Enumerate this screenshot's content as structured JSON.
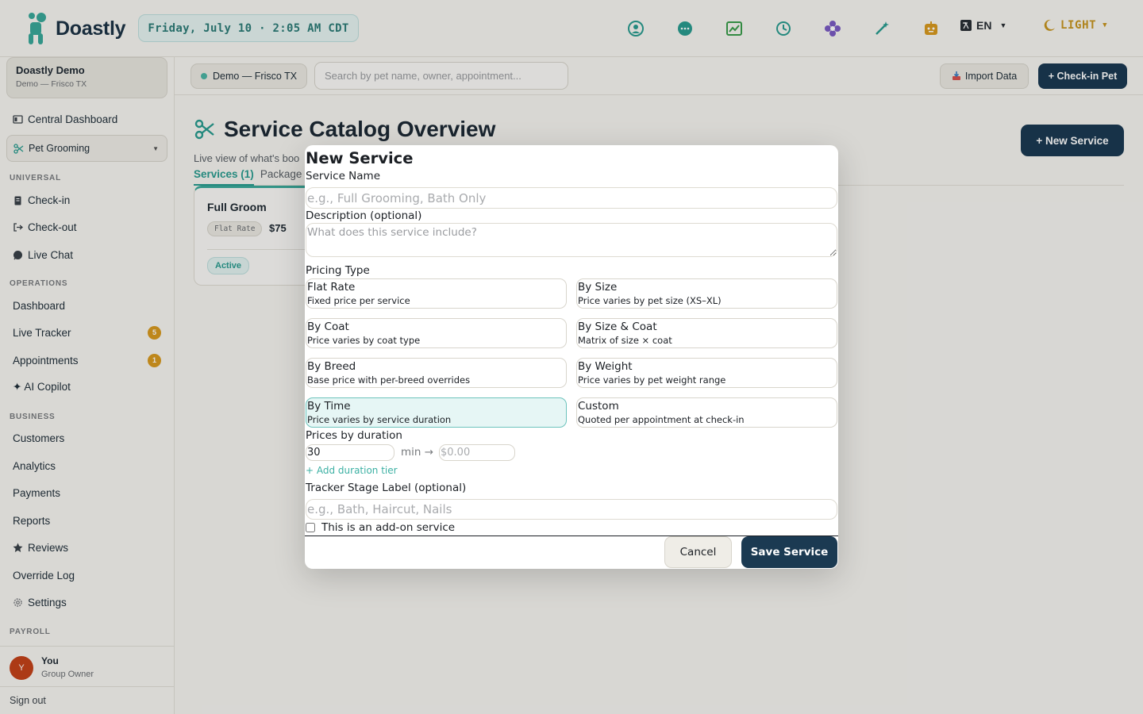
{
  "header": {
    "app_name": "Doastly",
    "date_time": "Friday, July 10 · 2:05 AM CDT",
    "language": "EN",
    "theme": "LIGHT",
    "icons": [
      "person-icon",
      "chat-bubble-icon",
      "trend-chart-icon",
      "clock-history-icon",
      "flower-icon",
      "magic-wand-icon",
      "robot-icon"
    ]
  },
  "sidebar": {
    "org_name": "Doastly Demo",
    "org_sub": "Demo — Frisco TX",
    "central_dashboard": "Central Dashboard",
    "active_module": "Pet Grooming",
    "section_universal": "UNIVERSAL",
    "universal_items": [
      "Check-in",
      "Check-out",
      "Live Chat"
    ],
    "section_operations": "OPERATIONS",
    "operations_items": [
      {
        "label": "Dashboard"
      },
      {
        "label": "Live Tracker",
        "badge": "5"
      },
      {
        "label": "Appointments",
        "badge": "1"
      },
      {
        "label": "✦ AI Copilot"
      }
    ],
    "section_business": "BUSINESS",
    "business_items": [
      "Customers",
      "Analytics",
      "Payments",
      "Reports",
      "Reviews",
      "Override Log",
      "Settings"
    ],
    "section_payroll": "PAYROLL",
    "user": {
      "initial": "Y",
      "name": "You",
      "role": "Group Owner"
    },
    "sign_out": "Sign out"
  },
  "subbar": {
    "location": "Demo — Frisco TX",
    "search_placeholder": "Search by pet name, owner, appointment...",
    "import_label": "Import Data",
    "checkin_label": "+ Check-in Pet"
  },
  "main": {
    "title": "Service Catalog Overview",
    "subtitle": "Live view of what's boo",
    "new_service_label": "+ New Service",
    "tabs": [
      "Services (1)",
      "Package"
    ],
    "card": {
      "name": "Full Groom",
      "pricing_chip": "Flat Rate",
      "price": "$75",
      "status": "Active"
    }
  },
  "modal": {
    "title": "New Service",
    "service_name_label": "Service Name",
    "service_name_placeholder": "e.g., Full Grooming, Bath Only",
    "description_label": "Description (optional)",
    "description_placeholder": "What does this service include?",
    "pricing_type_label": "Pricing Type",
    "pricing_options": [
      {
        "title": "Flat Rate",
        "desc": "Fixed price per service"
      },
      {
        "title": "By Size",
        "desc": "Price varies by pet size (XS–XL)"
      },
      {
        "title": "By Coat",
        "desc": "Price varies by coat type"
      },
      {
        "title": "By Size & Coat",
        "desc": "Matrix of size × coat"
      },
      {
        "title": "By Breed",
        "desc": "Base price with per-breed overrides"
      },
      {
        "title": "By Weight",
        "desc": "Price varies by pet weight range"
      },
      {
        "title": "By Time",
        "desc": "Price varies by service duration",
        "selected": true
      },
      {
        "title": "Custom",
        "desc": "Quoted per appointment at check-in"
      }
    ],
    "prices_by_duration_label": "Prices by duration",
    "duration_value": "30",
    "duration_unit": "min →",
    "price_placeholder": "$0.00",
    "add_tier_label": "+ Add duration tier",
    "tracker_label": "Tracker Stage Label (optional)",
    "tracker_placeholder": "e.g., Bath, Haircut, Nails",
    "addon_label": "This is an add-on service",
    "cancel_label": "Cancel",
    "save_label": "Save Service"
  },
  "colors": {
    "brand_navy": "#1b3a52",
    "teal": "#2a9d90",
    "badge_amber": "#d99a1f"
  }
}
